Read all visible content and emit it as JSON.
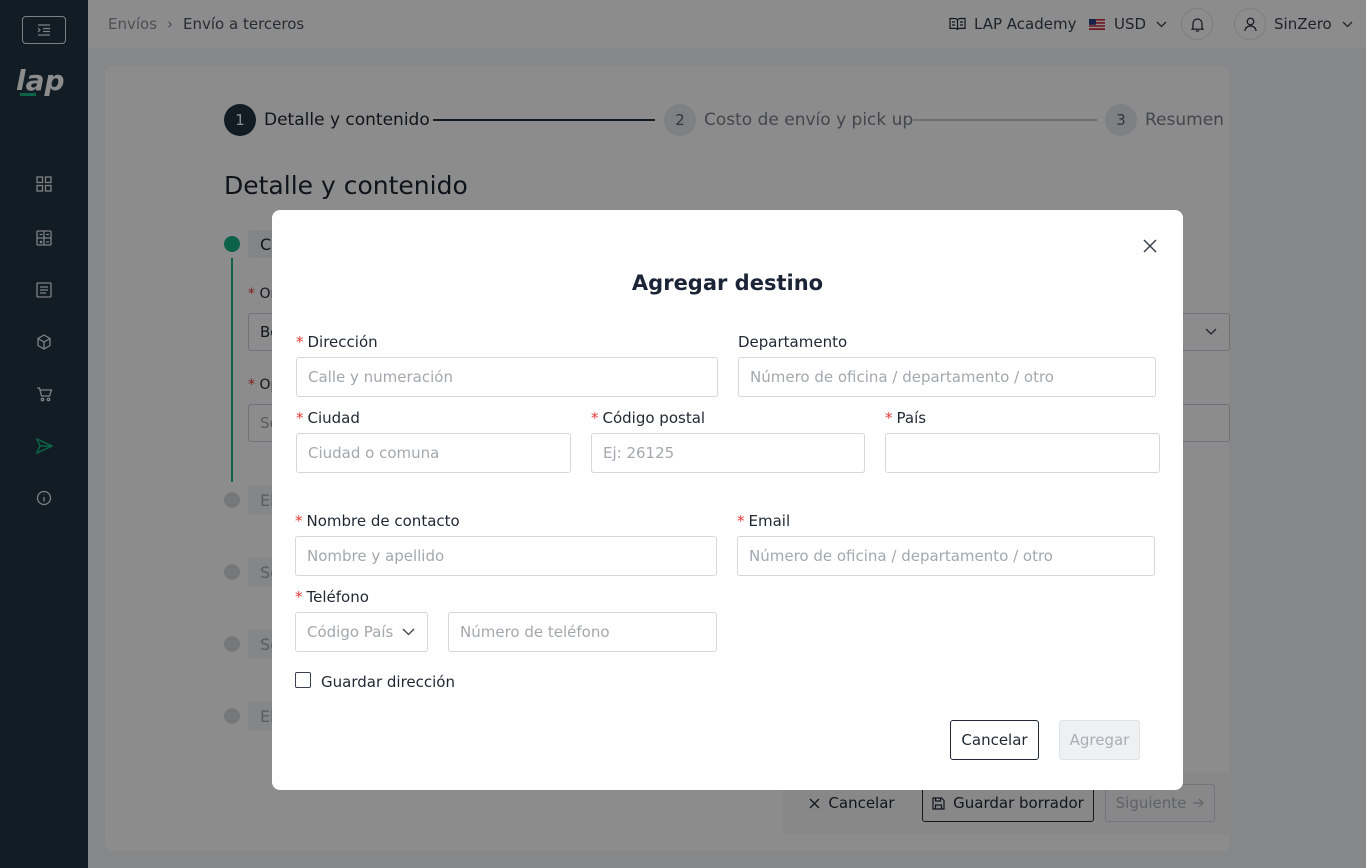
{
  "sidebar": {
    "logo_text": "lap",
    "items": [
      {
        "icon": "grid-icon"
      },
      {
        "icon": "calculator-icon"
      },
      {
        "icon": "list-icon"
      },
      {
        "icon": "box-icon"
      },
      {
        "icon": "cart-icon"
      },
      {
        "icon": "send-icon",
        "active": true
      },
      {
        "icon": "info-icon"
      }
    ]
  },
  "header": {
    "breadcrumb": [
      "Envíos",
      "Envío a terceros"
    ],
    "academy_label": "LAP Academy",
    "currency": "USD",
    "user_name": "SinZero"
  },
  "stepper": {
    "steps": [
      {
        "num": "1",
        "label": "Detalle y contenido"
      },
      {
        "num": "2",
        "label": "Costo de envío y pick up"
      },
      {
        "num": "3",
        "label": "Resumen"
      }
    ]
  },
  "page": {
    "heading": "Detalle y contenido",
    "bg_fragments": {
      "section1": "C",
      "origin_label": "Or",
      "origin_value": "Bo",
      "option_label": "Op",
      "option_value": "Se",
      "s2": "El",
      "s3": "Se",
      "s4": "Se",
      "s5": "El"
    }
  },
  "footer": {
    "cancel_label": "Cancelar",
    "save_draft_label": "Guardar borrador",
    "next_label": "Siguiente"
  },
  "modal": {
    "title": "Agregar destino",
    "fields": {
      "direccion": {
        "label": "Dirección",
        "placeholder": "Calle y numeración",
        "required": true
      },
      "departamento": {
        "label": "Departamento",
        "placeholder": "Número de oficina / departamento / otro",
        "required": false
      },
      "ciudad": {
        "label": "Ciudad",
        "placeholder": "Ciudad o comuna",
        "required": true
      },
      "codigo_postal": {
        "label": "Código postal",
        "placeholder": "Ej: 26125",
        "required": true
      },
      "pais": {
        "label": "País",
        "placeholder": "",
        "required": true
      },
      "nombre": {
        "label": "Nombre de contacto",
        "placeholder": "Nombre y apellido",
        "required": true
      },
      "email": {
        "label": "Email",
        "placeholder": "Número de oficina / departamento / otro",
        "required": true
      },
      "telefono": {
        "label": "Teléfono",
        "code_placeholder": "Código País",
        "placeholder": "Número de teléfono",
        "required": true
      }
    },
    "save_address_label": "Guardar dirección",
    "cancel_label": "Cancelar",
    "add_label": "Agregar"
  },
  "colors": {
    "sidebar_bg": "#1f3442",
    "accent_green": "#17b581",
    "step_active": "#1f3442",
    "required": "#e53935"
  }
}
